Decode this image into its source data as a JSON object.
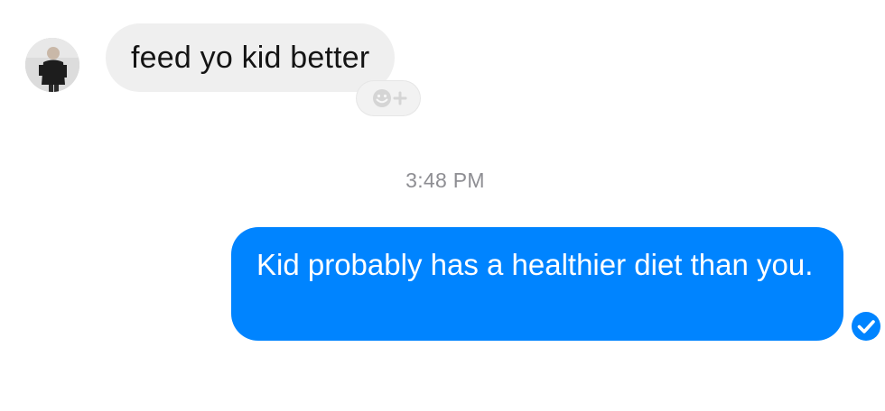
{
  "conversation": {
    "incoming": {
      "text": "feed yo kid better",
      "avatar_icon": "user-avatar-photo",
      "reaction_icon": "smiley-plus-icon"
    },
    "timestamp": "3:48 PM",
    "outgoing": {
      "text": "Kid probably has a healthier diet than you.",
      "status_icon": "check-circle-icon",
      "bubble_color": "#0084ff"
    }
  },
  "colors": {
    "incoming_bubble": "#efefef",
    "outgoing_bubble": "#0084ff",
    "timestamp": "#8e8e93",
    "background": "#ffffff"
  }
}
